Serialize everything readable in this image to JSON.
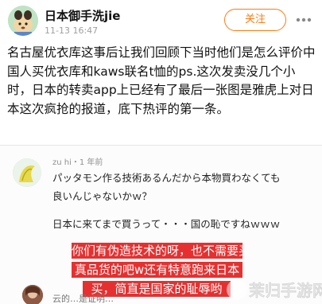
{
  "header": {
    "username": "日本御手洗jie",
    "timestamp": "11-13 16:47",
    "follow_label": "关注",
    "more_icon": "more-dots-icon"
  },
  "post": {
    "text": "名古屋优衣库这事后让我们回顾下当时他们是怎么评价中国人买优衣库和kaws联名t恤的ps.这次发卖没几个小时，日本的转卖app上已经有了最后一张图是雅虎上对日本这次疯抢的报道，底下热评的第一条。"
  },
  "embedded_image": {
    "comment_meta": "zu hi・1 年前",
    "comment_line1": "パッタモン作る技術あるんだから本物買わなくても",
    "comment_line2": "良いんじゃないかｗ？",
    "comment_line3": "日本に来てまで買うって・・・国の恥ですねｗｗｗ",
    "caption_line1": "你们有伪造技术的呀，也不需要买",
    "caption_line2": "真品货的吧w还有特意跑来日本",
    "caption_line3": "买，简直是国家的耻辱哟",
    "next_comment_partial": "云的…是证明…"
  },
  "watermark": {
    "text": "茉归手游网"
  },
  "colors": {
    "accent": "#ff7a12",
    "caption_bg": "#e41e1e"
  }
}
